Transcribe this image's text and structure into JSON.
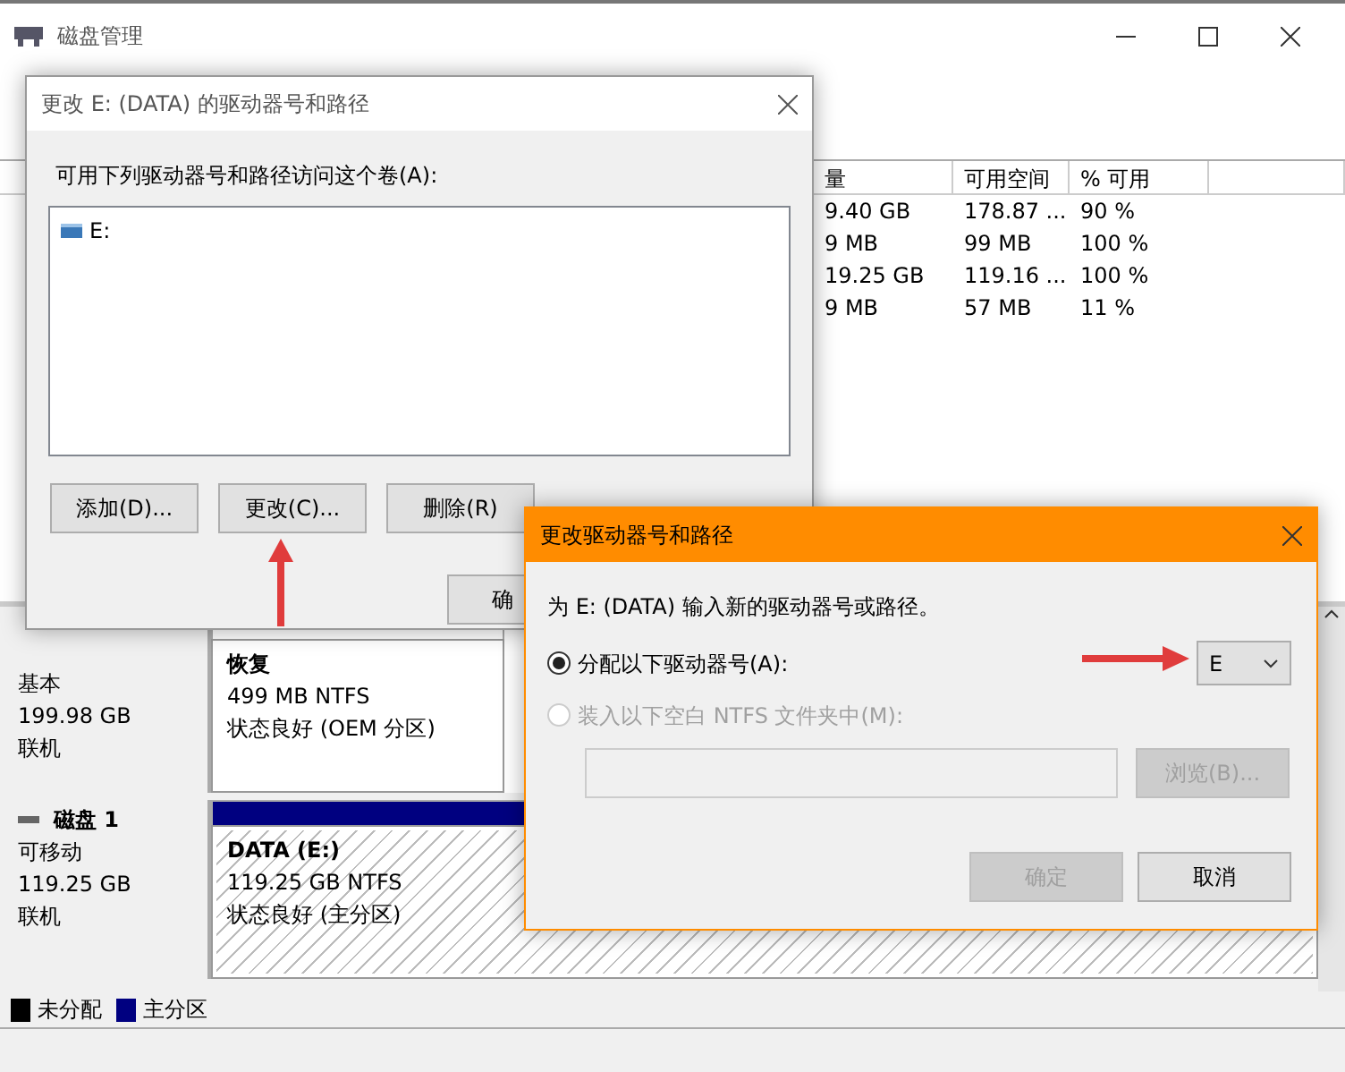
{
  "window": {
    "title": "磁盘管理"
  },
  "volume_table": {
    "columns": [
      "量",
      "可用空间",
      "% 可用"
    ],
    "rows": [
      [
        "9.40 GB",
        "178.87 ...",
        "90 %"
      ],
      [
        "9 MB",
        "99 MB",
        "100 %"
      ],
      [
        "19.25 GB",
        "119.16 ...",
        "100 %"
      ],
      [
        "9 MB",
        "57 MB",
        "11 %"
      ]
    ]
  },
  "disks": [
    {
      "details": [
        "基本",
        "199.98 GB",
        "联机"
      ],
      "partitions": [
        {
          "kind": "plain",
          "name": "恢复",
          "size": "499 MB NTFS",
          "status": "状态良好 (OEM 分区)"
        }
      ]
    },
    {
      "name": "磁盘 1",
      "details": [
        "可移动",
        "119.25 GB",
        "联机"
      ],
      "partitions": [
        {
          "kind": "hatched",
          "name": "DATA  (E:)",
          "size": "119.25 GB NTFS",
          "status": "状态良好 (主分区)"
        }
      ]
    }
  ],
  "legend": [
    {
      "label": "未分配",
      "color": "#000000"
    },
    {
      "label": "主分区",
      "color": "#000080"
    }
  ],
  "paths_dialog": {
    "title": "更改 E: (DATA) 的驱动器号和路径",
    "prompt": "可用下列驱动器号和路径访问这个卷(A):",
    "list": [
      {
        "label": "E:"
      }
    ],
    "buttons": [
      {
        "label": "添加(D)..."
      },
      {
        "label": "更改(C)..."
      },
      {
        "label": "删除(R)"
      }
    ],
    "ok_button": {
      "label": "确"
    }
  },
  "change_dialog": {
    "title": "更改驱动器号和路径",
    "prompt": "为 E: (DATA) 输入新的驱动器号或路径。",
    "options": [
      {
        "label": "分配以下驱动器号(A):",
        "selected": true,
        "disabled": false
      },
      {
        "label": "装入以下空白 NTFS 文件夹中(M):",
        "selected": false,
        "disabled": true
      }
    ],
    "letter_dropdown": {
      "value": "E"
    },
    "folder_field": {
      "disabled": true
    },
    "browse_button": {
      "label": "浏览(B)...",
      "disabled": true
    },
    "buttons": [
      {
        "label": "确定",
        "disabled": true
      },
      {
        "label": "取消",
        "disabled": false
      }
    ]
  }
}
